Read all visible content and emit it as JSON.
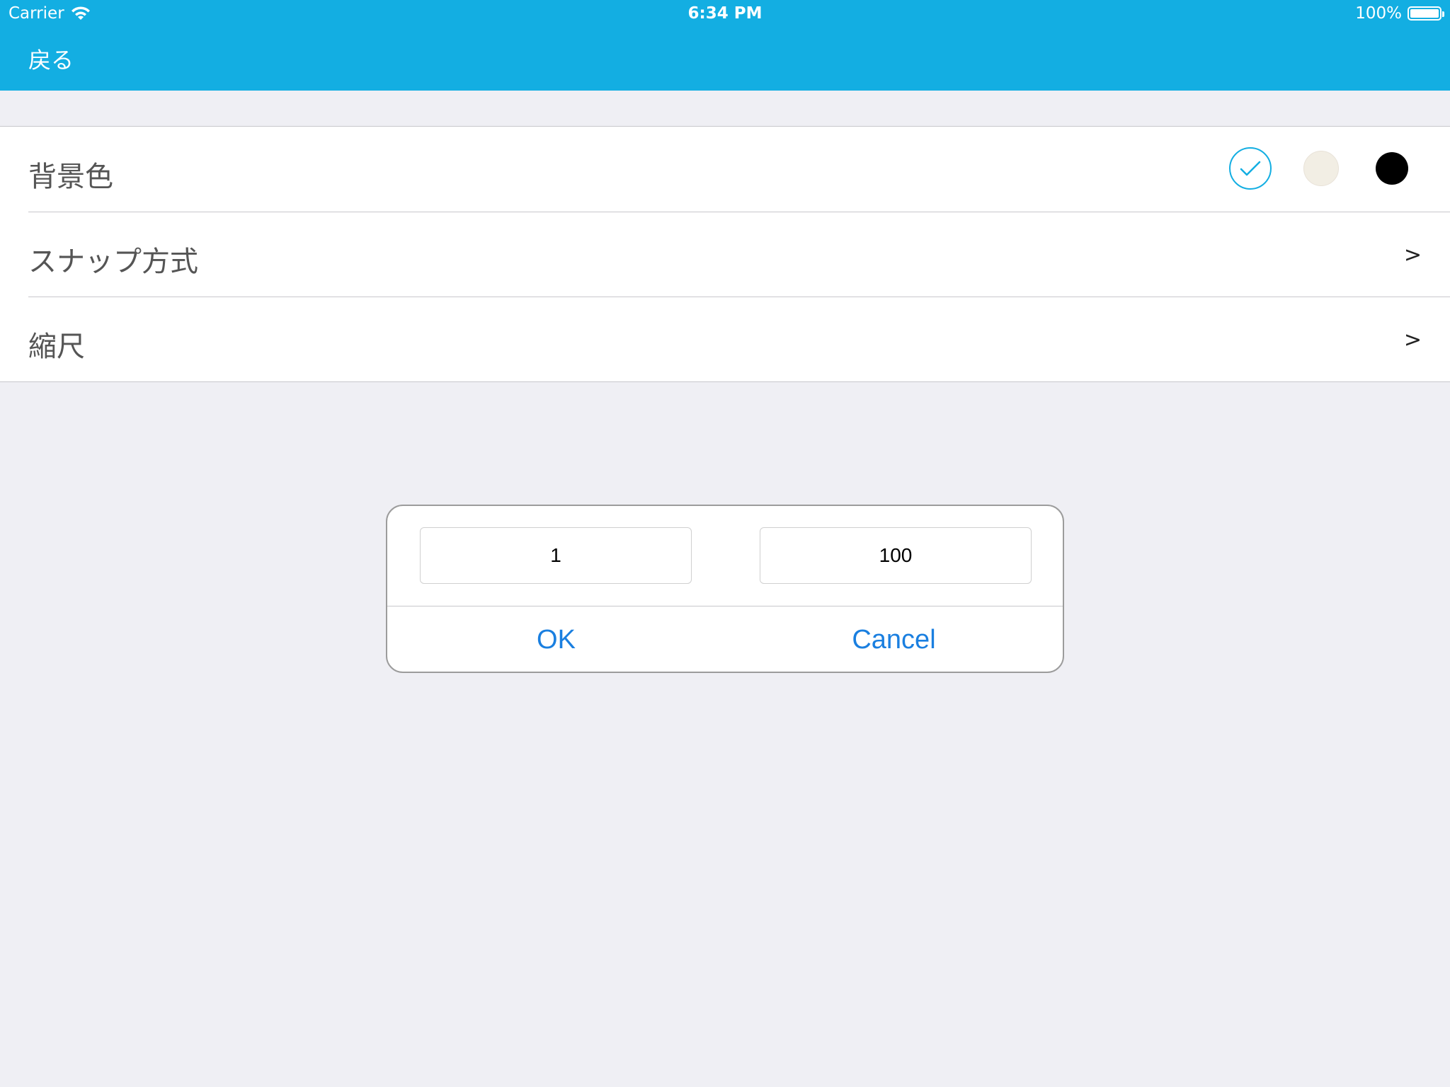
{
  "status_bar": {
    "carrier": "Carrier",
    "time": "6:34 PM",
    "battery": "100%"
  },
  "nav": {
    "back_label": "戻る"
  },
  "settings": {
    "rows": [
      {
        "label": "背景色"
      },
      {
        "label": "スナップ方式",
        "chevron": ">"
      },
      {
        "label": "縮尺",
        "chevron": ">"
      }
    ],
    "background_colors": [
      {
        "name": "white",
        "color": "#ffffff",
        "selected": true
      },
      {
        "name": "cream",
        "color": "#f2eee4",
        "selected": false
      },
      {
        "name": "black",
        "color": "#000000",
        "selected": false
      }
    ]
  },
  "dialog": {
    "input_from": "1",
    "input_to": "100",
    "ok_label": "OK",
    "cancel_label": "Cancel"
  },
  "colors": {
    "accent": "#13aee2",
    "background": "#efeff4",
    "button_text": "#1a7fe0"
  },
  "icons": {
    "wifi": "wifi-icon",
    "battery": "battery-icon",
    "check": "checkmark-icon",
    "chevron": "chevron-right-icon"
  }
}
